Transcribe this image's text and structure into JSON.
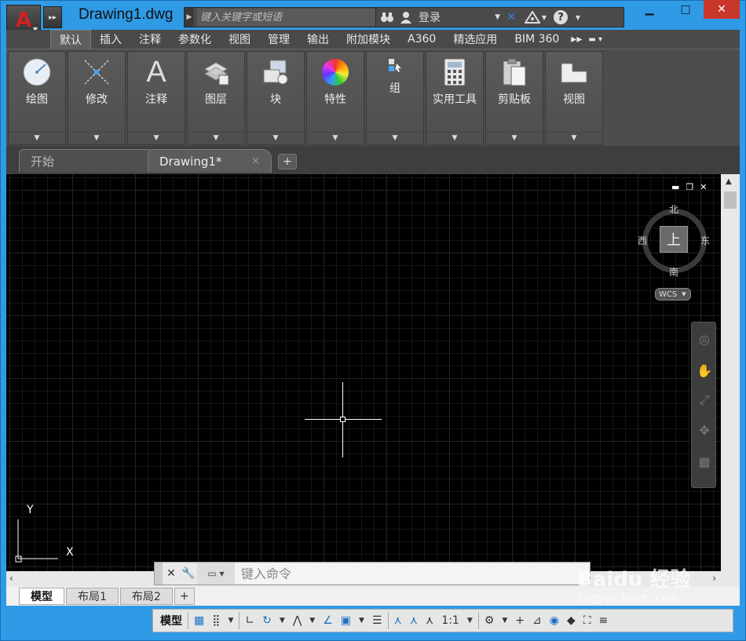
{
  "app": {
    "doc_title": "Drawing1.dwg",
    "logo_letter": "A"
  },
  "search": {
    "placeholder": "键入关键字或短语"
  },
  "topbar": {
    "signin": "登录",
    "help": "?"
  },
  "ribbon_tabs": [
    "默认",
    "插入",
    "注释",
    "参数化",
    "视图",
    "管理",
    "输出",
    "附加模块",
    "A360",
    "精选应用",
    "BIM 360"
  ],
  "panels": [
    {
      "label": "绘图",
      "icon": "draw-circle-icon"
    },
    {
      "label": "修改",
      "icon": "modify-icon"
    },
    {
      "label": "注释",
      "icon": "annotation-text-icon"
    },
    {
      "label": "图层",
      "icon": "layers-icon"
    },
    {
      "label": "块",
      "icon": "block-icon"
    },
    {
      "label": "特性",
      "icon": "properties-color-wheel-icon"
    },
    {
      "label": "组",
      "icon": "group-icon"
    },
    {
      "label": "实用工具",
      "icon": "calculator-icon"
    },
    {
      "label": "剪贴板",
      "icon": "clipboard-icon"
    },
    {
      "label": "视图",
      "icon": "view-icon"
    }
  ],
  "file_tabs": {
    "start": "开始",
    "drawing": "Drawing1*",
    "close": "×",
    "add": "+"
  },
  "viewcube": {
    "north": "北",
    "south": "南",
    "west": "西",
    "east": "东",
    "top": "上",
    "wcs": "WCS"
  },
  "ucs": {
    "x": "X",
    "y": "Y"
  },
  "command": {
    "placeholder": "键入命令"
  },
  "layout_tabs": [
    "模型",
    "布局1",
    "布局2"
  ],
  "status": {
    "model": "模型",
    "scale": "1:1"
  },
  "watermark": {
    "brand": "Baidu 经验",
    "url": "jingyan.baidu.com"
  },
  "colors": {
    "accent": "#2f9ae6",
    "canvas": "#000000",
    "close": "#c9372c"
  }
}
